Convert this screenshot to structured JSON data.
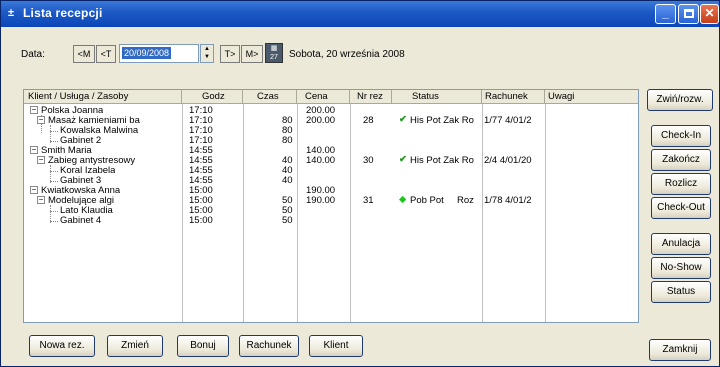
{
  "window": {
    "title": "Lista recepcji",
    "app_icon": "list-icon"
  },
  "titlebar": {
    "minimize": "_",
    "close": "✕"
  },
  "toolbar": {
    "date_label": "Data:",
    "btn_prev_month": "<M",
    "btn_prev_day": "<T",
    "date_value": "20/09/2008",
    "btn_next_day": "T>",
    "btn_next_month": "M>",
    "calendar_label": "27",
    "date_text": "Sobota, 20 września 2008"
  },
  "columns": {
    "klient": "Klient / Usługa / Zasoby",
    "godz": "Godz",
    "czas": "Czas",
    "cena": "Cena",
    "nr_rez": "Nr rez",
    "status": "Status",
    "rachunek": "Rachunek",
    "uwagi": "Uwagi"
  },
  "rows": [
    {
      "name": "Polska Joanna",
      "godz": "17:10",
      "czas": "",
      "cena": "200.00",
      "nr": "",
      "status": "",
      "rach": ""
    },
    {
      "name": "Masaż kamieniami ba",
      "godz": "17:10",
      "czas": "80",
      "cena": "200.00",
      "nr": "28",
      "status": "His Pot Zak Ro",
      "rach": "1/77  4/01/2"
    },
    {
      "name": "Kowalska Malwina",
      "godz": "17:10",
      "czas": "80",
      "cena": "",
      "nr": "",
      "status": "",
      "rach": ""
    },
    {
      "name": "Gabinet 2",
      "godz": "17:10",
      "czas": "80",
      "cena": "",
      "nr": "",
      "status": "",
      "rach": ""
    },
    {
      "name": "Smith Maria",
      "godz": "14:55",
      "czas": "",
      "cena": "140.00",
      "nr": "",
      "status": "",
      "rach": ""
    },
    {
      "name": "Zabieg antystresowy",
      "godz": "14:55",
      "czas": "40",
      "cena": "140.00",
      "nr": "30",
      "status": "His Pot Zak Ro",
      "rach": "2/4  4/01/20"
    },
    {
      "name": "Koral Izabela",
      "godz": "14:55",
      "czas": "40",
      "cena": "",
      "nr": "",
      "status": "",
      "rach": ""
    },
    {
      "name": "Gabinet 3",
      "godz": "14:55",
      "czas": "40",
      "cena": "",
      "nr": "",
      "status": "",
      "rach": ""
    },
    {
      "name": "Kwiatkowska Anna",
      "godz": "15:00",
      "czas": "",
      "cena": "190.00",
      "nr": "",
      "status": "",
      "rach": ""
    },
    {
      "name": "Modelujące algi",
      "godz": "15:00",
      "czas": "50",
      "cena": "190.00",
      "nr": "31",
      "status": "Pob Pot     Roz",
      "rach": "1/78  4/01/2"
    },
    {
      "name": "Lato Klaudia",
      "godz": "15:00",
      "czas": "50",
      "cena": "",
      "nr": "",
      "status": "",
      "rach": ""
    },
    {
      "name": "Gabinet 4",
      "godz": "15:00",
      "czas": "50",
      "cena": "",
      "nr": "",
      "status": "",
      "rach": ""
    }
  ],
  "side_buttons": {
    "zwin": "Zwiń/rozw.",
    "checkin": "Check-In",
    "zakoncz": "Zakończ",
    "rozlicz": "Rozlicz",
    "checkout": "Check-Out",
    "anulacja": "Anulacja",
    "noshow": "No-Show",
    "status": "Status"
  },
  "bottom_buttons": {
    "nowa": "Nowa rez.",
    "zmien": "Zmień",
    "bonuj": "Bonuj",
    "rachunek": "Rachunek",
    "klient": "Klient",
    "zamknij": "Zamknij"
  }
}
